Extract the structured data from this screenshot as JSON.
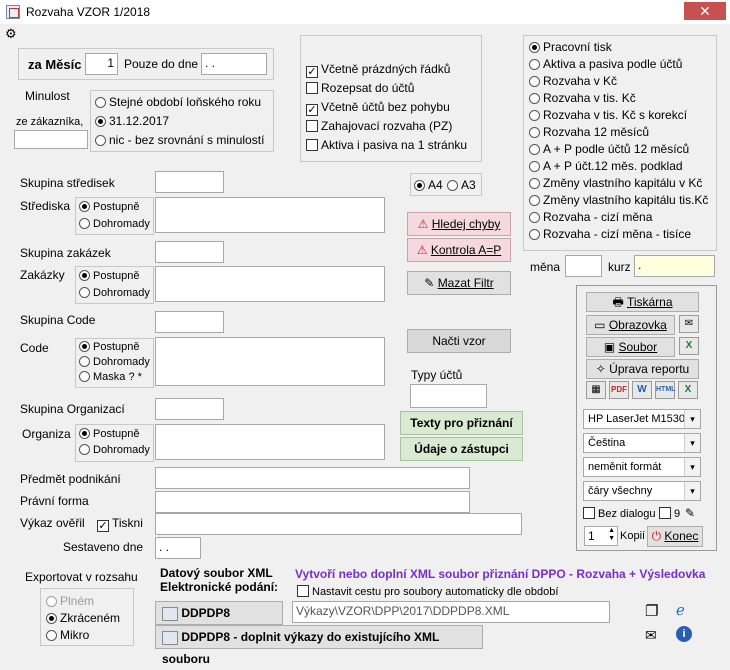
{
  "window": {
    "title": "Rozvaha   VZOR   1/2018",
    "close_glyph": "✕"
  },
  "period": {
    "label": "za Měsíc",
    "value": "1",
    "until_label": "Pouze do dne",
    "until_value": " . .",
    "minulost_label": "Minulost",
    "customer_label": "ze zákazníka,",
    "options": [
      "Stejné období loňského roku",
      "31.12.2017",
      "nic - bez srovnání s minulostí"
    ]
  },
  "options_box": [
    {
      "label": "Včetně prázdných řádků",
      "checked": true
    },
    {
      "label": "Rozepsat do účtů",
      "checked": false
    },
    {
      "label": "Včetně účtů bez pohybu",
      "checked": true
    },
    {
      "label": "Zahajovací rozvaha (PZ)",
      "checked": false
    },
    {
      "label": "Aktiva i pasiva na 1 stránku",
      "checked": false
    }
  ],
  "report_types": [
    "Pracovní tisk",
    "Aktiva a pasiva podle účtů",
    "Rozvaha v Kč",
    "Rozvaha v tis. Kč",
    "Rozvaha v tis. Kč s korekcí",
    "Rozvaha 12 měsíců",
    "A + P podle účtů 12 měsíců",
    "A + P účt.12 měs. podklad",
    "Změny vlastního kapitálu v Kč",
    "Změny vlastního kapitálu tis.Kč",
    "Rozvaha - cizí měna",
    "Rozvaha - cizí měna - tisíce"
  ],
  "currency": {
    "mena_label": "měna",
    "kurz_label": "kurz",
    "kurz_value": "."
  },
  "paper": {
    "a4": "A4",
    "a3": "A3"
  },
  "filters": {
    "skupina_strediska": "Skupina středisek",
    "strediska": "Střediska",
    "skupina_zakazek": "Skupina zakázek",
    "zakazky": "Zakázky",
    "skupina_code": "Skupina Code",
    "code": "Code",
    "skupina_org": "Skupina Organizací",
    "organizace": "Organiza",
    "postupne": "Postupně",
    "dohromady": "Dohromady",
    "maska": "Maska  ? *"
  },
  "buttons": {
    "hledej": "Hledej chyby",
    "kontrola": "Kontrola A=P",
    "mazat": "Mazat Filtr",
    "nacti": "Načti vzor",
    "typy_uctu": "Typy účtů",
    "texty": "Texty pro přiznání",
    "udaje": "Údaje o zástupci"
  },
  "output_panel": {
    "tiskarna": "Tiskárna",
    "obrazovka": "Obrazovka",
    "soubor": "Soubor",
    "uprava": "Úprava reportu",
    "file_icons": [
      "calendar-icon",
      "pdf-icon",
      "word-icon",
      "html-icon",
      "excel-icon"
    ],
    "printer": "HP LaserJet M1530",
    "language": "Čeština",
    "format": "neměnit formát",
    "lines": "čáry všechny",
    "bez_dialogu": "Bez dialogu",
    "nine": "9",
    "copies_value": "1",
    "kopii": "Kopií",
    "konec": "Konec"
  },
  "company": {
    "predmet": "Předmět podnikání",
    "pravni": "Právní forma",
    "vykaz": "Výkaz ověřil",
    "tiskni": "Tiskni",
    "sestaveno": "Sestaveno dne",
    "sestaveno_value": " . ."
  },
  "export": {
    "label": "Exportovat v rozsahu",
    "options": [
      "Plném",
      "Zkráceném",
      "Mikro"
    ],
    "datovy": "Datový soubor XML",
    "elektronicke": "Elektronické podání:",
    "headline": "Vytvoří nebo doplní XML soubor přiznání DPPO - Rozvaha + Výsledovka",
    "auto_path": "Nastavit cestu pro soubory automaticky dle období",
    "btn1": "DDPDP8",
    "path": "Výkazy\\VZOR\\DPP\\2017\\DDPDP8.XML",
    "btn2": "DDPDP8 - doplnit výkazy do existujícího XML souboru"
  },
  "colors": {
    "close": "#c75050",
    "purple": "#7a2ec9",
    "green_btn": "#d9ead3",
    "pink_btn": "#f4d9e1"
  }
}
